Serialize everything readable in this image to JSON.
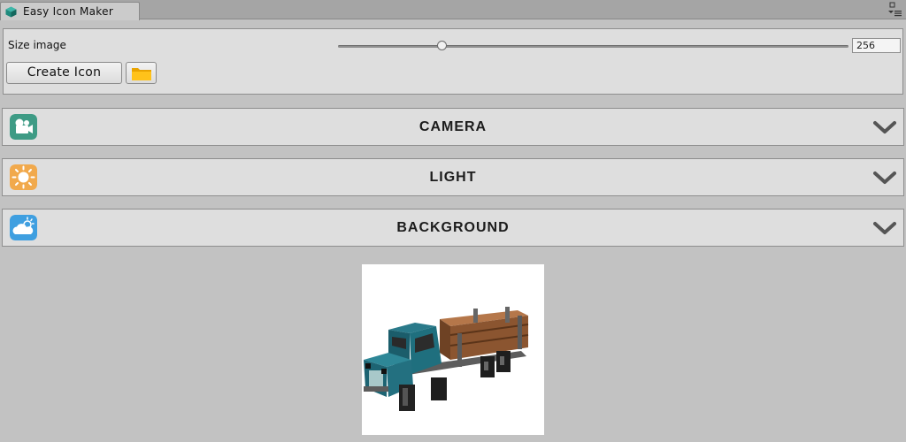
{
  "window": {
    "title": "Easy Icon Maker",
    "tab_icon": "cube-icon",
    "controls_icon": "window-menu-icon"
  },
  "toolbar": {
    "size_label": "Size image",
    "size_value": "256",
    "slider_fraction": 0.2,
    "create_button": "Create Icon",
    "folder_icon": "folder-icon"
  },
  "sections": [
    {
      "title": "CAMERA",
      "icon": "camera-icon",
      "color": "#3e9b85"
    },
    {
      "title": "LIGHT",
      "icon": "sun-icon",
      "color": "#f1a94c"
    },
    {
      "title": "BACKGROUND",
      "icon": "cloud-sun-icon",
      "color": "#3f9fe0"
    }
  ],
  "preview": {
    "image": "voxel-truck-image",
    "background": "#ffffff"
  }
}
